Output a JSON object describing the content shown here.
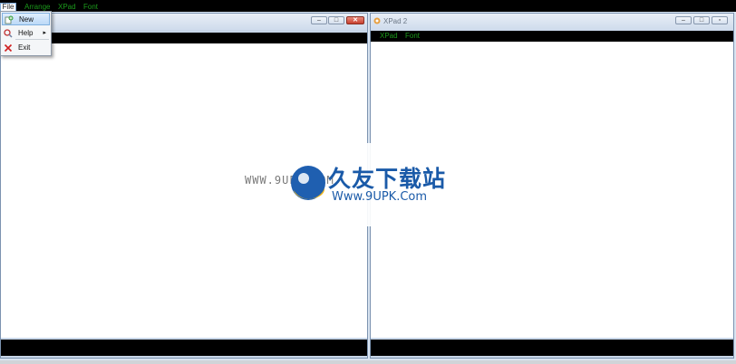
{
  "menubar": {
    "items": [
      "File",
      "Arrange",
      "XPad",
      "Font"
    ]
  },
  "file_menu": {
    "items": [
      {
        "label": "New",
        "icon": "new-document-icon",
        "selected": true
      },
      {
        "label": "Help",
        "icon": "help-icon",
        "submenu": true
      },
      {
        "label": "Exit",
        "icon": "close-x-icon"
      }
    ]
  },
  "windows": [
    {
      "id": "left",
      "title": "",
      "menu": [],
      "controls": [
        "minimize",
        "maximize",
        "close"
      ]
    },
    {
      "id": "right",
      "title": "XPad 2",
      "menu": [
        "XPad",
        "Font"
      ],
      "controls": [
        "minimize",
        "maximize",
        "close"
      ]
    }
  ],
  "watermark": {
    "left_url": "WWW.9UPK.COM",
    "brand_cn": "久友下载站",
    "brand_url": "Www.9UPK.Com"
  },
  "colors": {
    "menu_text": "#1b9a1b",
    "close_button": "#c8402e",
    "watermark_blue": "#1a5aa8"
  }
}
